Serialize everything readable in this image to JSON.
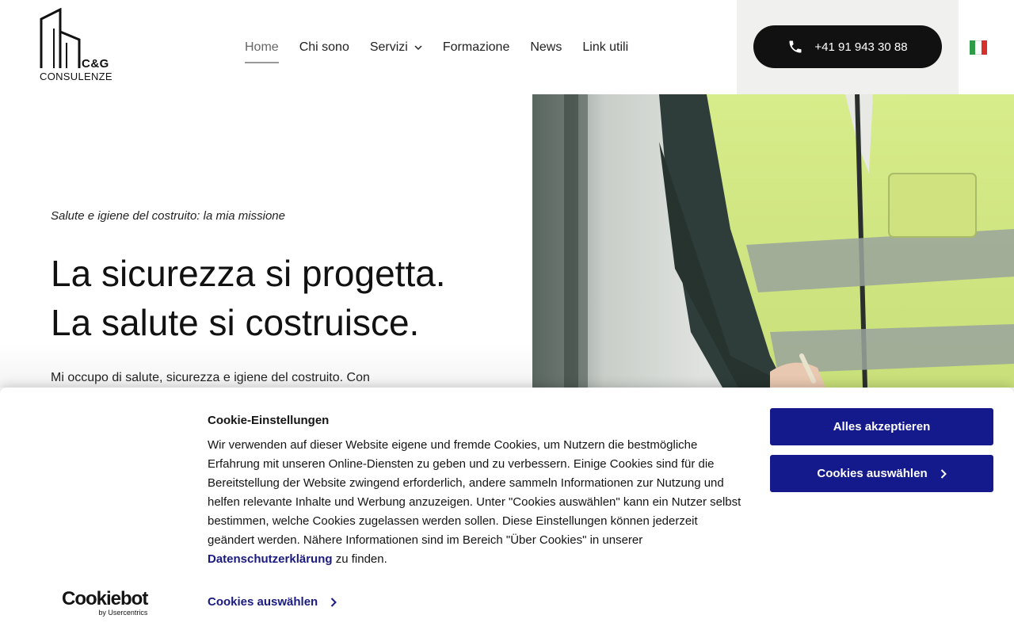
{
  "brand": {
    "logo_text": "C&G",
    "logo_subtext": "CONSULENZE"
  },
  "nav": {
    "items": [
      {
        "label": "Home",
        "active": true
      },
      {
        "label": "Chi sono"
      },
      {
        "label": "Servizi",
        "has_dropdown": true
      },
      {
        "label": "Formazione"
      },
      {
        "label": "News"
      },
      {
        "label": "Link utili"
      }
    ]
  },
  "contact": {
    "phone": "+41 91 943 30 88",
    "icon": "phone-icon"
  },
  "language": {
    "flag": "italian-flag-icon",
    "colors": [
      "#2e9b46",
      "#ffffff",
      "#d6302c"
    ]
  },
  "hero": {
    "kicker": "Salute e igiene del costruito: la mia missione",
    "headline_line1": "La sicurezza si progetta.",
    "headline_line2": "La salute si costruisce.",
    "intro": "Mi occupo di salute, sicurezza e igiene del costruito. Con"
  },
  "cookie": {
    "title": "Cookie-Einstellungen",
    "text_before_link": "Wir verwenden auf dieser Website eigene und fremde Cookies, um Nutzern die bestmögliche Erfahrung mit unseren Online-Diensten zu geben und zu verbessern. Einige Cookies sind für die Bereitstellung der Website zwingend erforderlich, andere sammeln Informationen zur Nutzung und helfen relevante Inhalte und Werbung anzuzeigen. Unter \"Cookies auswählen\" kann ein Nutzer selbst bestimmen, welche Cookies zugelassen werden sollen. Diese Einstellungen können jederzeit geändert werden. Nähere Informationen sind im Bereich \"Über Cookies\" in unserer ",
    "link_label": "Datenschutzerklärung",
    "text_after_link": " zu finden.",
    "accept_label": "Alles akzeptieren",
    "select_label": "Cookies auswählen",
    "details_label": "Cookies auswählen",
    "provider_name": "Cookiebot",
    "provider_by": "by Usercentrics",
    "accent_color": "#141a8c"
  }
}
